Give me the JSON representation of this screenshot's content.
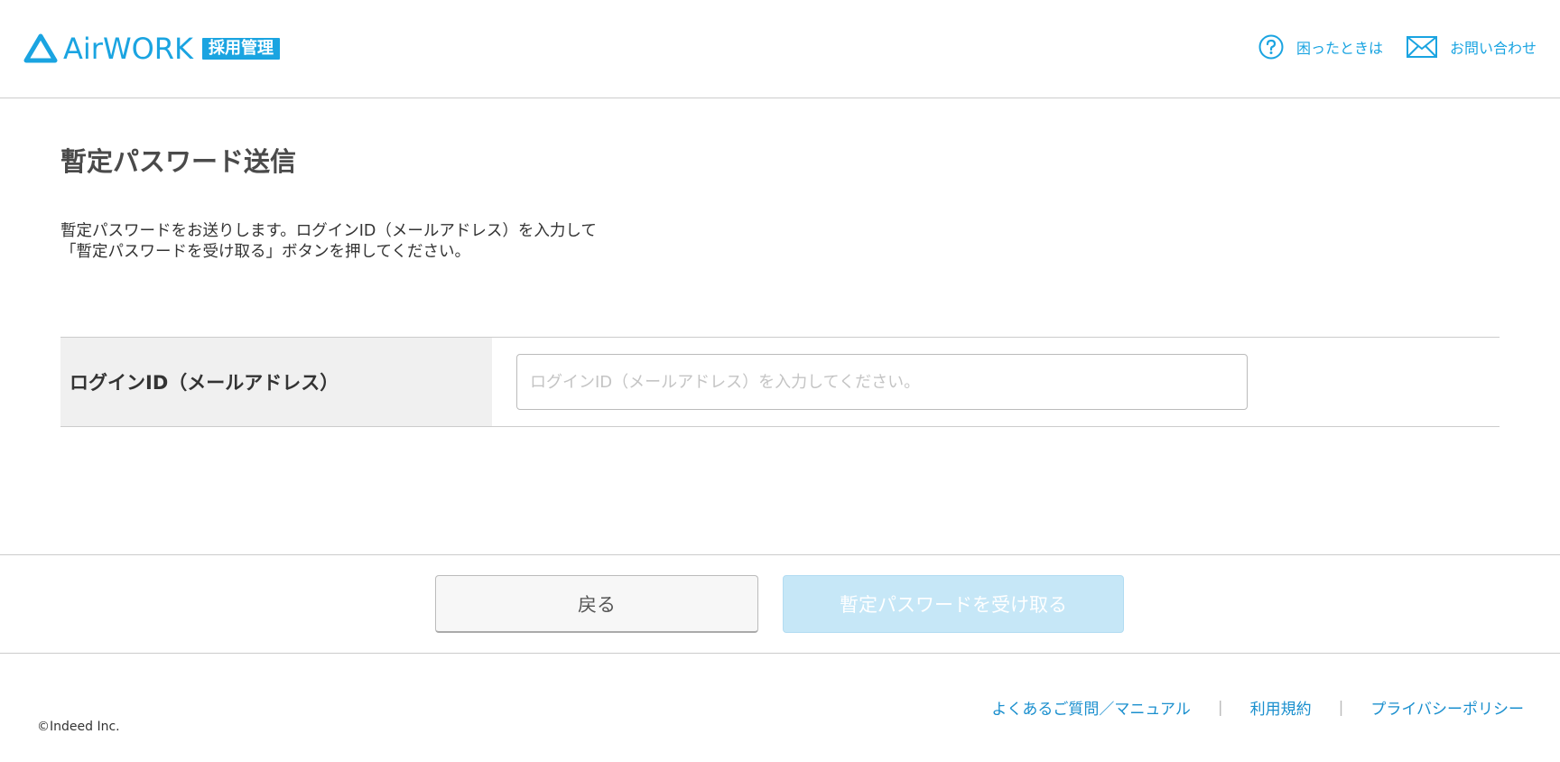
{
  "colors": {
    "brand": "#1aa4e1",
    "link": "#1a8fce",
    "submit_disabled": "#c6e7f7",
    "label_bg": "#f0f0f0"
  },
  "header": {
    "logo_text": "AirWORK",
    "logo_badge": "採用管理",
    "help_icon": "question-circle-icon",
    "help_label": "困ったときは",
    "contact_icon": "envelope-icon",
    "contact_label": "お問い合わせ"
  },
  "main": {
    "title": "暫定パスワード送信",
    "description_line1": "暫定パスワードをお送りします。ログインID（メールアドレス）を入力して",
    "description_line2": "「暫定パスワードを受け取る」ボタンを押してください。",
    "form": {
      "login_label": "ログインID（メールアドレス）",
      "login_value": "",
      "login_placeholder": "ログインID（メールアドレス）を入力してください。"
    }
  },
  "actions": {
    "back_label": "戻る",
    "submit_label": "暫定パスワードを受け取る"
  },
  "footer": {
    "links": [
      "よくあるご質問／マニュアル",
      "利用規約",
      "プライバシーポリシー"
    ],
    "separator": "|",
    "copyright": "©Indeed Inc."
  }
}
